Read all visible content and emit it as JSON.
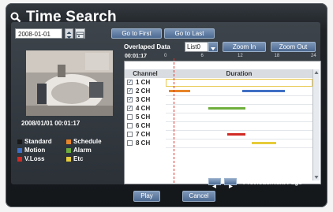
{
  "window": {
    "title": "Time Search"
  },
  "date_row": {
    "date_value": "2008-01-01",
    "goto_first_label": "Go to First",
    "goto_last_label": "Go to Last"
  },
  "overlap_row": {
    "label": "Overlaped Data",
    "list_value": "List0",
    "zoom_in_label": "Zoom In",
    "zoom_out_label": "Zoom Out"
  },
  "preview": {
    "timestamp": "2008/01/01  00:01:17"
  },
  "timeline": {
    "time_readout": "00:01:17",
    "ticks": [
      "0",
      "6",
      "12",
      "18",
      "24"
    ],
    "cursor_hours": 1.3
  },
  "table": {
    "channel_header": "Channel",
    "duration_header": "Duration",
    "rows": [
      {
        "label": "1 CH",
        "checked": true,
        "highlight": true,
        "segments": []
      },
      {
        "label": "2 CH",
        "checked": true,
        "highlight": false,
        "segments": [
          {
            "start": 0.5,
            "end": 4,
            "type": "schedule"
          },
          {
            "start": 12.5,
            "end": 19.5,
            "type": "motion"
          }
        ]
      },
      {
        "label": "3 CH",
        "checked": true,
        "highlight": false,
        "segments": []
      },
      {
        "label": "4 CH",
        "checked": true,
        "highlight": false,
        "segments": [
          {
            "start": 7,
            "end": 13,
            "type": "alarm"
          }
        ]
      },
      {
        "label": "5 CH",
        "checked": false,
        "highlight": false,
        "segments": []
      },
      {
        "label": "6 CH",
        "checked": false,
        "highlight": false,
        "segments": []
      },
      {
        "label": "7 CH",
        "checked": false,
        "highlight": false,
        "segments": [
          {
            "start": 10,
            "end": 13,
            "type": "vloss"
          }
        ]
      },
      {
        "label": "8 CH",
        "checked": false,
        "highlight": false,
        "segments": [
          {
            "start": 14,
            "end": 18,
            "type": "etc"
          }
        ]
      }
    ]
  },
  "legend": {
    "standard": "Standard",
    "schedule": "Schedule",
    "motion": "Motion",
    "alarm": "Alarm",
    "vloss": "V.Loss",
    "etc": "Etc"
  },
  "colors": {
    "standard": "#1a1a1a",
    "schedule": "#e8842a",
    "motion": "#3f6fc4",
    "alarm": "#6fae3c",
    "vloss": "#d22a25",
    "etc": "#e6cc3a"
  },
  "pager": {
    "label": "Previous/Next Page"
  },
  "footer": {
    "play_label": "Play",
    "cancel_label": "Cancel"
  }
}
